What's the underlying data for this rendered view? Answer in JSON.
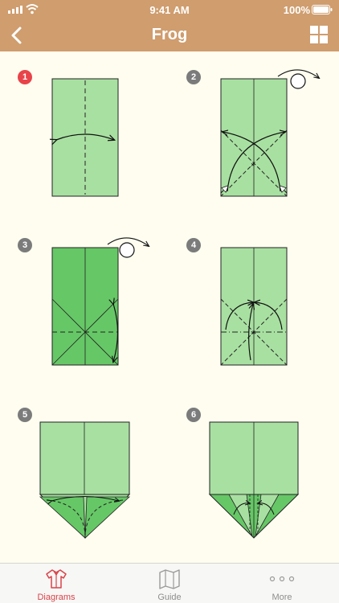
{
  "status_bar": {
    "time": "9:41 AM",
    "battery": "100%"
  },
  "nav": {
    "title": "Frog",
    "back_icon": "chevron-left-icon",
    "right_icon": "grid-icon"
  },
  "steps": [
    {
      "number": "1",
      "active": true
    },
    {
      "number": "2",
      "active": false
    },
    {
      "number": "3",
      "active": false
    },
    {
      "number": "4",
      "active": false
    },
    {
      "number": "5",
      "active": false
    },
    {
      "number": "6",
      "active": false
    }
  ],
  "tabs": [
    {
      "label": "Diagrams",
      "icon": "shirt-icon",
      "active": true
    },
    {
      "label": "Guide",
      "icon": "map-icon",
      "active": false
    },
    {
      "label": "More",
      "icon": "more-dots-icon",
      "active": false
    }
  ],
  "colors": {
    "header": "#cf9d6e",
    "background": "#fefdf0",
    "paper_light": "#a8e0a1",
    "paper_dark": "#66c766",
    "active_badge": "#e8434a",
    "active_tab": "#d9434b"
  }
}
